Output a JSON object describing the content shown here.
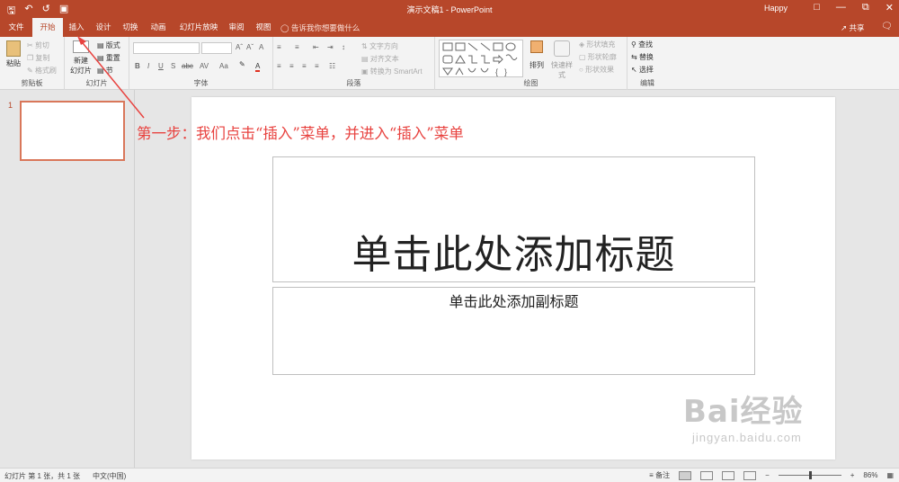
{
  "app": {
    "doc_title": "演示文稿1 - PowerPoint",
    "user": "Happy",
    "qat_icons": [
      "save-icon",
      "undo-icon",
      "redo-icon",
      "start-from-beginning-icon"
    ],
    "win_controls": [
      "restore-ribbon-icon",
      "minimize-icon",
      "maximize-icon",
      "close-icon"
    ]
  },
  "tabs": [
    {
      "label": "文件"
    },
    {
      "label": "开始"
    },
    {
      "label": "插入"
    },
    {
      "label": "设计"
    },
    {
      "label": "切换"
    },
    {
      "label": "动画"
    },
    {
      "label": "幻灯片放映"
    },
    {
      "label": "审阅"
    },
    {
      "label": "视图"
    }
  ],
  "tellme": "告诉我你想要做什么",
  "share": "共享",
  "ribbon": {
    "clipboard": {
      "label": "剪贴板",
      "paste": "粘贴",
      "cut": "剪切",
      "copy": "复制",
      "format_painter": "格式刷"
    },
    "slides": {
      "label": "幻灯片",
      "new_slide": "新建",
      "new_slide2": "幻灯片",
      "layout": "版式",
      "reset": "重置",
      "section": "节"
    },
    "font": {
      "label": "字体",
      "bold": "B",
      "italic": "I",
      "underline": "U",
      "shadow": "S",
      "strike": "abc",
      "spacing": "AV",
      "case": "Aa",
      "grow": "A",
      "shrink": "A",
      "clear": "A",
      "color": "A"
    },
    "paragraph": {
      "label": "段落",
      "text_direction": "文字方向",
      "align_text": "对齐文本",
      "smartart": "转换为 SmartArt"
    },
    "drawing": {
      "label": "绘图",
      "arrange": "排列",
      "quick_styles": "快速样式",
      "shape_fill": "形状填充",
      "shape_outline": "形状轮廓",
      "shape_effects": "形状效果"
    },
    "editing": {
      "label": "编辑",
      "find": "查找",
      "replace": "替换",
      "select": "选择"
    }
  },
  "thumbnails": [
    {
      "number": "1"
    }
  ],
  "slide": {
    "title_placeholder": "单击此处添加标题",
    "subtitle_placeholder": "单击此处添加副标题"
  },
  "annotation": {
    "text": "第一步：我们点击“插入”菜单，并进入“插入”菜单",
    "color": "#e8423f"
  },
  "watermark": {
    "brand": "Bai经验",
    "url": "jingyan.baidu.com"
  },
  "statusbar": {
    "slide_info": "幻灯片 第 1 张，共 1 张",
    "language": "中文(中国)",
    "notes": "备注",
    "zoom": "86%"
  },
  "colors": {
    "accent": "#b7472a",
    "ribbon_bg": "#f3f3f3"
  }
}
